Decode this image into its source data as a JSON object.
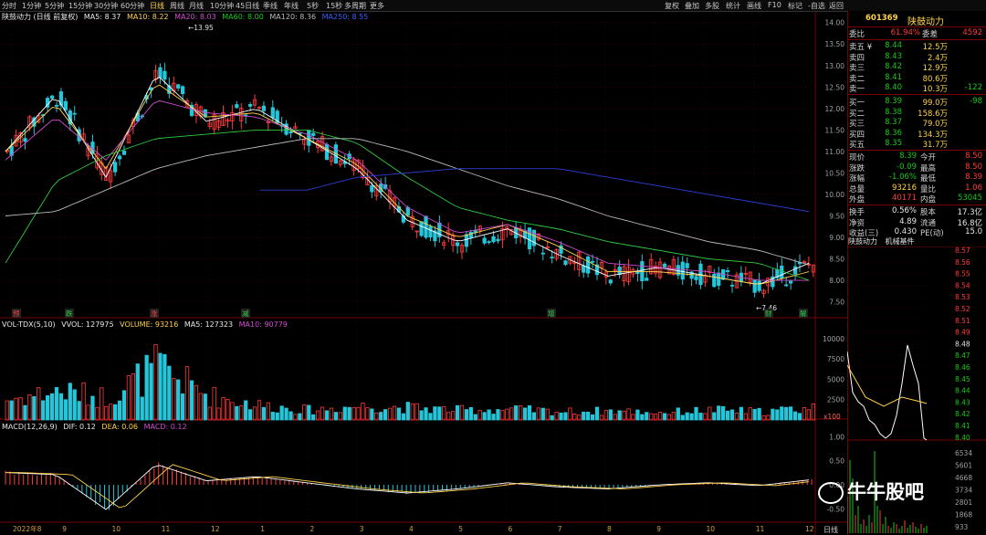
{
  "periods": [
    "分时",
    "1分钟",
    "5分钟",
    "15分钟",
    "30分钟",
    "60分钟",
    "日线",
    "周线",
    "月线",
    "10分钟",
    "45日线",
    "季线",
    "年线",
    "5秒",
    "15秒",
    "多周期",
    "更多"
  ],
  "active_period": "日线",
  "toolbar": [
    "复权",
    "叠加",
    "多股",
    "统计",
    "画线",
    "F10",
    "标记",
    "-自选",
    "返回"
  ],
  "price_indicator": {
    "name": "陕鼓动力 (日线 前复权)",
    "ma5": "MA5: 8.37",
    "ma10": "MA10: 8.22",
    "ma20": "MA20: 8.03",
    "ma60": "MA60: 8.00",
    "ma120": "MA120: 8.36",
    "ma250": "MA250: 8.55"
  },
  "vol_indicator": {
    "name": "VOL-TDX(5,10)",
    "vvol": "VVOL: 127975",
    "volume": "VOLUME: 93216",
    "ma5": "MA5: 127323",
    "ma10": "MA10: 90779"
  },
  "macd_indicator": {
    "name": "MACD(12,26,9)",
    "dif": "DIF: 0.12",
    "dea": "DEA: 0.06",
    "macd": "MACD: 0.12"
  },
  "price_axis": [
    "14.00",
    "13.50",
    "13.00",
    "12.50",
    "12.00",
    "11.50",
    "11.00",
    "10.50",
    "10.00",
    "9.50",
    "9.00",
    "8.50",
    "8.00",
    "7.50"
  ],
  "vol_axis": [
    "10000",
    "7500",
    "5000",
    "2500"
  ],
  "vol_unit": "x100",
  "macd_axis": [
    "1.00",
    "0.50",
    "0.00",
    "-0.50"
  ],
  "time_axis": [
    "2022年8",
    "9",
    "10",
    "11",
    "12",
    "1",
    "2",
    "3",
    "4",
    "5",
    "6",
    "7",
    "8",
    "9",
    "10",
    "11",
    "12"
  ],
  "annotations": {
    "high": "13.95",
    "low": "7.46"
  },
  "markers": [
    "预",
    "跌",
    "涨",
    "减",
    "增",
    "财",
    "解"
  ],
  "right_panel": {
    "code": "601369",
    "name": "陕鼓动力",
    "weibi_label": "委比",
    "weibi": "61.94%",
    "weicha_label": "委差",
    "weicha": "4592",
    "asks": [
      {
        "label": "卖五",
        "flag": "¥",
        "price": "8.44",
        "vol": "12.5万",
        "chg": ""
      },
      {
        "label": "卖四",
        "flag": "",
        "price": "8.43",
        "vol": "2.4万",
        "chg": ""
      },
      {
        "label": "卖三",
        "flag": "",
        "price": "8.42",
        "vol": "12.9万",
        "chg": ""
      },
      {
        "label": "卖二",
        "flag": "",
        "price": "8.41",
        "vol": "80.6万",
        "chg": ""
      },
      {
        "label": "卖一",
        "flag": "",
        "price": "8.40",
        "vol": "10.3万",
        "chg": "-122"
      }
    ],
    "bids": [
      {
        "label": "买一",
        "price": "8.39",
        "vol": "99.0万",
        "chg": "-98"
      },
      {
        "label": "买二",
        "price": "8.38",
        "vol": "158.6万",
        "chg": ""
      },
      {
        "label": "买三",
        "price": "8.37",
        "vol": "79.0万",
        "chg": ""
      },
      {
        "label": "买四",
        "price": "8.36",
        "vol": "134.3万",
        "chg": ""
      },
      {
        "label": "买五",
        "price": "8.35",
        "vol": "31.7万",
        "chg": ""
      }
    ],
    "quote": [
      {
        "l1": "现价",
        "v1": "8.39",
        "l2": "今开",
        "v2": "8.50"
      },
      {
        "l1": "涨跌",
        "v1": "-0.09",
        "l2": "最高",
        "v2": "8.50"
      },
      {
        "l1": "涨幅",
        "v1": "-1.06%",
        "l2": "最低",
        "v2": "8.39"
      },
      {
        "l1": "总量",
        "v1": "93216",
        "l2": "量比",
        "v2": "1.06"
      },
      {
        "l1": "外盘",
        "v1": "40171",
        "l2": "内盘",
        "v2": "53045"
      }
    ],
    "stats": [
      {
        "l1": "换手",
        "v1": "0.56%",
        "l2": "股本",
        "v2": "17.3亿"
      },
      {
        "l1": "净资",
        "v1": "4.89",
        "l2": "流通",
        "v2": "16.8亿"
      },
      {
        "l1": "收益(三)",
        "v1": "0.430",
        "l2": "PE(动)",
        "v2": "15.0"
      }
    ],
    "mini_tabs": [
      "陕鼓动力",
      "机械基件"
    ],
    "mini_axis": [
      "8.57",
      "8.56",
      "8.55",
      "8.54",
      "8.53",
      "8.52",
      "8.51",
      "8.49",
      "8.48",
      "8.47",
      "8.46",
      "8.45",
      "8.44",
      "8.43",
      "8.42",
      "8.41",
      "8.40"
    ],
    "mini_vol_axis": [
      "6534",
      "5601",
      "4668",
      "3734",
      "2801",
      "1868",
      "933"
    ],
    "bottom_tab": "日线"
  },
  "watermark": "牛牛股吧",
  "colors": {
    "up": "#ff3b3b",
    "down": "#25c6d9",
    "ma5": "#ffffff",
    "ma10": "#ffd24a",
    "ma20": "#d04bd0",
    "ma60": "#2ecc40",
    "ma120": "#bbbbbb",
    "ma250": "#2b3ed6"
  },
  "chart_data": {
    "type": "line",
    "title": "陕鼓动力 (日线 前复权)",
    "x": [
      "2022年8",
      "9",
      "10",
      "11",
      "12",
      "1",
      "2",
      "3",
      "4",
      "5",
      "6",
      "7",
      "8",
      "9",
      "10",
      "11",
      "12"
    ],
    "ylim": [
      7.3,
      14.1
    ],
    "series": [
      {
        "name": "MA5",
        "values": [
          11.0,
          12.3,
          10.4,
          12.8,
          11.7,
          12.0,
          11.3,
          10.6,
          9.4,
          8.9,
          9.2,
          8.6,
          8.1,
          8.3,
          8.1,
          7.9,
          8.4
        ]
      },
      {
        "name": "MA10",
        "values": [
          11.0,
          12.1,
          10.6,
          12.6,
          11.8,
          11.9,
          11.3,
          10.7,
          9.5,
          9.0,
          9.3,
          8.8,
          8.2,
          8.2,
          8.1,
          7.9,
          8.2
        ]
      },
      {
        "name": "MA20",
        "values": [
          10.8,
          11.8,
          10.8,
          12.2,
          11.9,
          11.8,
          11.4,
          10.8,
          9.7,
          9.1,
          9.3,
          8.9,
          8.4,
          8.3,
          8.2,
          8.0,
          8.0
        ]
      },
      {
        "name": "MA60",
        "values": [
          8.4,
          10.3,
          10.9,
          11.3,
          11.4,
          11.5,
          11.5,
          11.2,
          10.4,
          9.7,
          9.4,
          9.2,
          8.9,
          8.7,
          8.5,
          8.4,
          8.0
        ]
      },
      {
        "name": "MA120",
        "values": [
          9.5,
          9.6,
          10.1,
          10.6,
          10.9,
          11.1,
          11.3,
          11.3,
          11.0,
          10.6,
          10.2,
          9.9,
          9.5,
          9.2,
          8.9,
          8.7,
          8.36
        ]
      },
      {
        "name": "MA250",
        "values": [
          null,
          null,
          null,
          null,
          null,
          null,
          10.1,
          10.4,
          10.5,
          10.6,
          10.6,
          10.6,
          10.4,
          10.2,
          10.0,
          9.8,
          9.6
        ]
      }
    ],
    "annotations": {
      "high": 13.95,
      "low": 7.46
    },
    "volume": {
      "values": [
        2500,
        3500,
        2800,
        6500,
        3000,
        1800,
        1200,
        1700,
        1500,
        1200,
        1300,
        1000,
        1100,
        900,
        1200,
        1000,
        1500
      ],
      "ylim": [
        0,
        11000
      ]
    },
    "macd": {
      "values": [
        0.3,
        0.25,
        -0.6,
        0.5,
        0.1,
        0.2,
        0.05,
        -0.1,
        -0.2,
        -0.1,
        0.05,
        -0.05,
        -0.1,
        0.0,
        0.05,
        -0.02,
        0.12
      ],
      "ylim": [
        -0.7,
        1.1
      ]
    }
  }
}
